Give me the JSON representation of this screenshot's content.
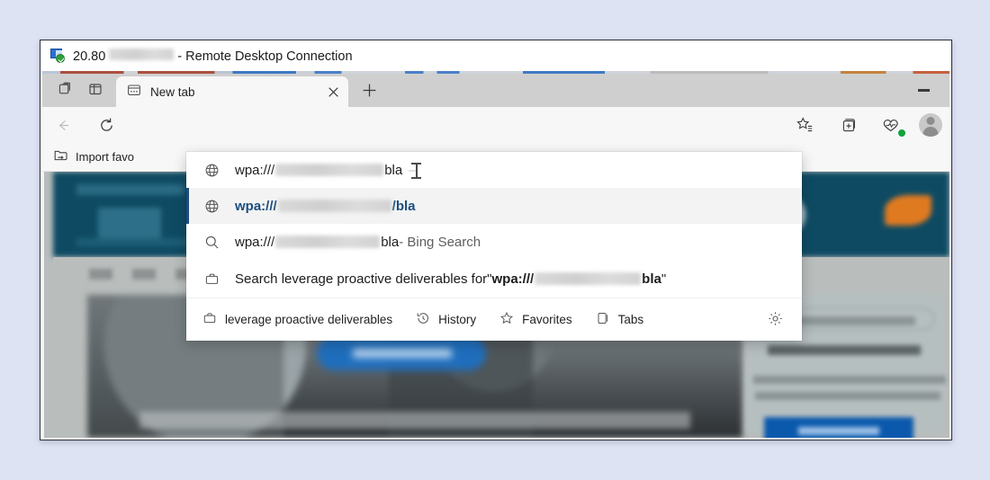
{
  "window": {
    "title_prefix": "20.80",
    "title_suffix": " - Remote Desktop Connection",
    "icon": "remote-desktop-icon",
    "minimize_label": "—"
  },
  "browser": {
    "tab_actions_icon": "tab-actions-icon",
    "split_screen_icon": "vertical-tabs-icon",
    "tab": {
      "favicon": "new-tab-page-icon",
      "title": "New tab",
      "close_icon": "close-icon"
    },
    "new_tab_icon": "plus-icon",
    "nav": {
      "back_icon": "back-arrow-icon",
      "refresh_icon": "refresh-icon",
      "favorites_icon": "favorites-star-icon",
      "collections_icon": "collections-icon",
      "browser_essentials_icon": "browser-essentials-icon",
      "profile_icon": "profile-avatar-icon"
    },
    "bookmarks": {
      "import_icon": "import-favorites-icon",
      "import_label": "Import favo"
    }
  },
  "omnibox": {
    "suggestions": [
      {
        "icon": "globe-icon",
        "prefix": "wpa:///",
        "redacted": true,
        "suffix": "bla",
        "trailing": "–",
        "selected": false,
        "bold": false
      },
      {
        "icon": "globe-icon",
        "prefix": "wpa:///",
        "redacted": true,
        "suffix": "/bla",
        "trailing": "",
        "selected": true,
        "bold": true
      },
      {
        "icon": "search-icon",
        "prefix": "wpa:///",
        "redacted": true,
        "suffix": "bla",
        "trailing": " - Bing Search",
        "selected": false,
        "bold": false
      }
    ],
    "search_row": {
      "icon": "work-briefcase-icon",
      "lead": "Search leverage proactive deliverables for ",
      "quote_open": "\"",
      "query_prefix": "wpa:///",
      "query_suffix": "bla",
      "quote_close": "\""
    },
    "footer": {
      "profile_icon": "work-briefcase-icon",
      "profile_label": "leverage proactive deliverables",
      "history_icon": "history-clock-icon",
      "history_label": "History",
      "favorites_icon": "favorites-star-icon",
      "favorites_label": "Favorites",
      "tabs_icon": "tabs-icon",
      "tabs_label": "Tabs",
      "settings_icon": "gear-icon"
    }
  },
  "colors": {
    "desktop_background": "#dee3f3",
    "selection_accent": "#1b4d7e",
    "page_hero": "#0e4b63",
    "hero_button": "#1f6ebd",
    "side_button": "#0a59ad"
  }
}
